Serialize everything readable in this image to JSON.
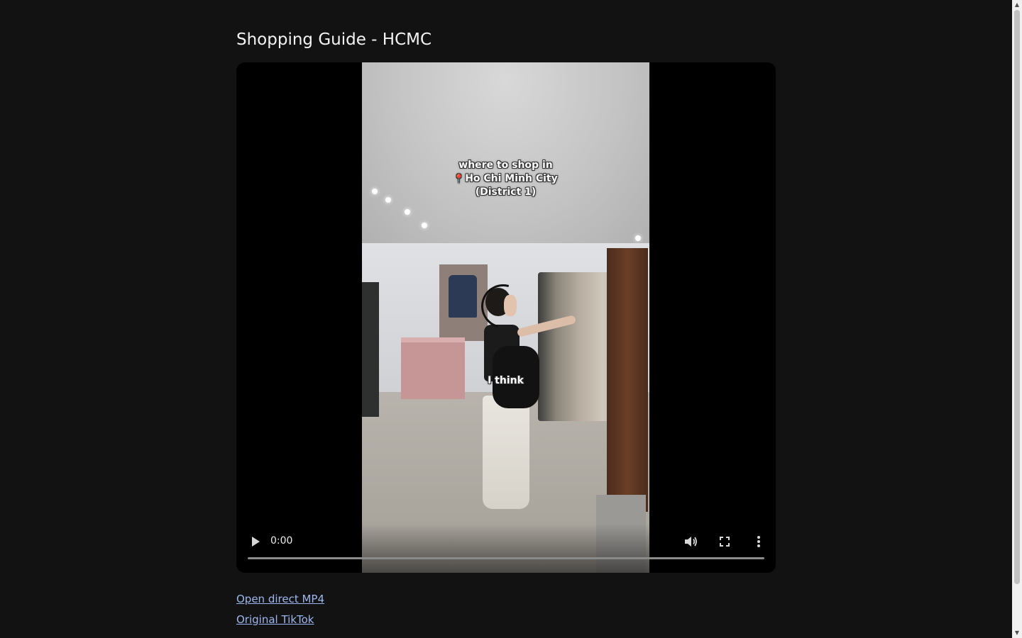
{
  "page": {
    "title": "Shopping Guide - HCMC"
  },
  "video": {
    "caption_top": [
      "where to shop in",
      "Ho Chi Minh City",
      "(District 1)"
    ],
    "caption_mid": "I think",
    "pin_icon": "📍",
    "time": "0:00",
    "progress": 0,
    "icons": {
      "play": "play-icon",
      "volume": "volume-icon",
      "fullscreen": "fullscreen-icon",
      "more": "more-vert-icon"
    }
  },
  "links": {
    "direct_mp4": "Open direct MP4",
    "original_tiktok": "Original TikTok"
  },
  "colors": {
    "background": "#121212",
    "link": "#9db7ee",
    "player": "#000000"
  }
}
